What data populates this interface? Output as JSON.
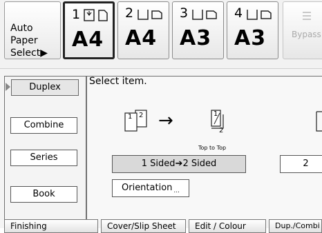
{
  "paper_select": {
    "auto_label_line1": "Auto Paper",
    "auto_label_line2": "Select▶",
    "trays": [
      {
        "number": "1",
        "size": "A4",
        "selected": true
      },
      {
        "number": "2",
        "size": "A4",
        "selected": false
      },
      {
        "number": "3",
        "size": "A3",
        "selected": false
      },
      {
        "number": "4",
        "size": "A3",
        "selected": false
      }
    ],
    "bypass_label": "Bypass..."
  },
  "sidebar": {
    "items": [
      {
        "label": "Duplex",
        "active": true
      },
      {
        "label": "Combine",
        "active": false
      },
      {
        "label": "Series",
        "active": false
      },
      {
        "label": "Book",
        "active": false
      }
    ]
  },
  "main": {
    "prompt": "Select item.",
    "diagram_page_1": "1",
    "diagram_page_2": "2",
    "diagram_arrow": "→",
    "diagram_result_1": "1",
    "diagram_result_2": "2",
    "caption": "Top to Top",
    "mode_button": "1 Sided➔2 Sided",
    "mode_button_2": "2",
    "orientation_button": "Orientation"
  },
  "bottom_tabs": [
    {
      "label": "Finishing"
    },
    {
      "label": "Cover/Slip Sheet"
    },
    {
      "label": "Edit / Colour"
    },
    {
      "label": "Dup./Combi"
    }
  ]
}
